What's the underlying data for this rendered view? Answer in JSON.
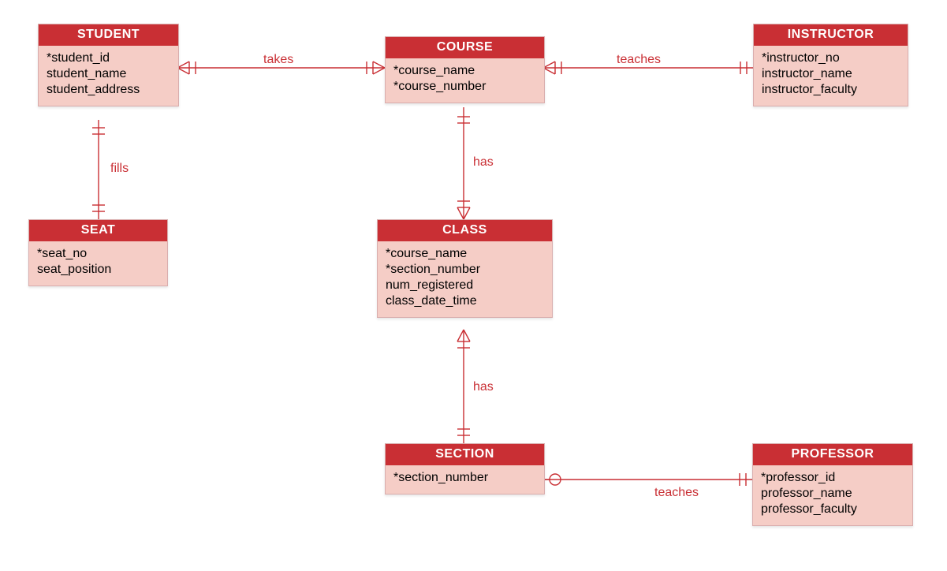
{
  "entities": {
    "student": {
      "title": "STUDENT",
      "attrs": [
        "*student_id",
        "student_name",
        "student_address"
      ]
    },
    "course": {
      "title": "COURSE",
      "attrs": [
        "*course_name",
        "*course_number"
      ]
    },
    "instructor": {
      "title": "INSTRUCTOR",
      "attrs": [
        "*instructor_no",
        "instructor_name",
        "instructor_faculty"
      ]
    },
    "seat": {
      "title": "SEAT",
      "attrs": [
        "*seat_no",
        "seat_position"
      ]
    },
    "class": {
      "title": "CLASS",
      "attrs": [
        "*course_name",
        "*section_number",
        "num_registered",
        "class_date_time"
      ]
    },
    "section": {
      "title": "SECTION",
      "attrs": [
        "*section_number"
      ]
    },
    "professor": {
      "title": "PROFESSOR",
      "attrs": [
        "*professor_id",
        "professor_name",
        "professor_faculty"
      ]
    }
  },
  "relationships": {
    "takes": "takes",
    "teaches1": "teaches",
    "fills": "fills",
    "has1": "has",
    "has2": "has",
    "teaches2": "teaches"
  }
}
